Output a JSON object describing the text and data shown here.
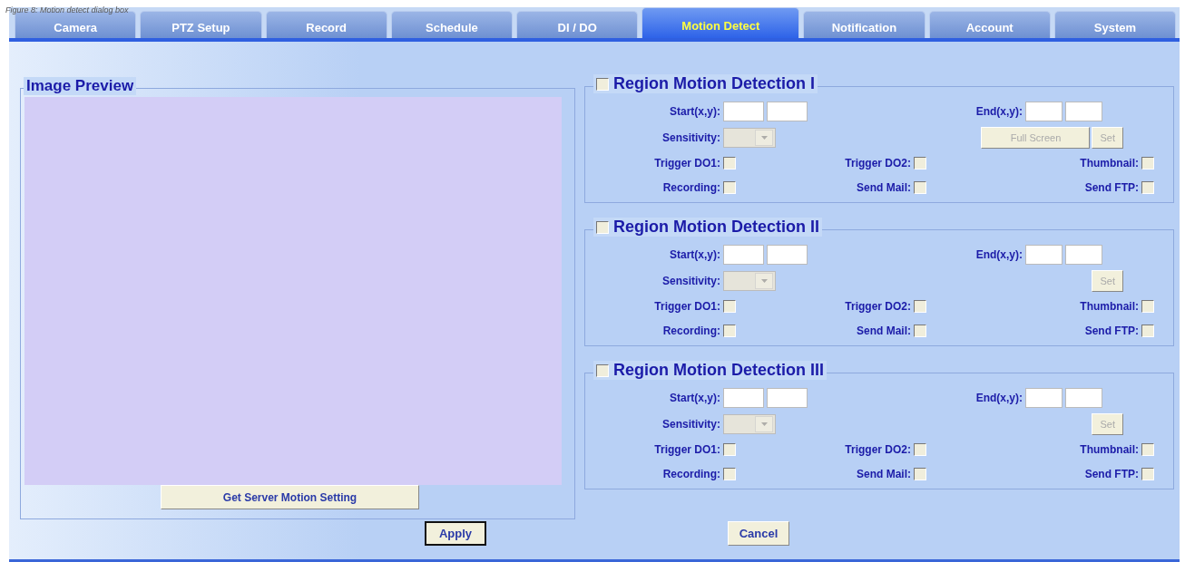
{
  "caption": "Figure 8:   Motion detect dialog box",
  "tabs": [
    {
      "label": "Camera",
      "selected": false
    },
    {
      "label": "PTZ Setup",
      "selected": false
    },
    {
      "label": "Record",
      "selected": false
    },
    {
      "label": "Schedule",
      "selected": false
    },
    {
      "label": "DI / DO",
      "selected": false
    },
    {
      "label": "Motion Detect",
      "selected": true
    },
    {
      "label": "Notification",
      "selected": false
    },
    {
      "label": "Account",
      "selected": false
    },
    {
      "label": "System",
      "selected": false
    }
  ],
  "image_preview": {
    "title": "Image Preview",
    "button": "Get Server Motion Setting"
  },
  "regions": [
    {
      "title": "Region Motion Detection I",
      "enabled": false,
      "start_label": "Start(x,y):",
      "end_label": "End(x,y):",
      "sensitivity_label": "Sensitivity:",
      "sensitivity_disabled": true,
      "buttons": [
        {
          "label": "Full Screen",
          "disabled": true
        },
        {
          "label": "Set",
          "disabled": true
        }
      ],
      "options": [
        {
          "label": "Trigger DO1:",
          "checked": false
        },
        {
          "label": "Trigger DO2:",
          "checked": false
        },
        {
          "label": "Thumbnail:",
          "checked": false
        },
        {
          "label": "Recording:",
          "checked": false
        },
        {
          "label": "Send Mail:",
          "checked": false
        },
        {
          "label": "Send FTP:",
          "checked": false
        }
      ]
    },
    {
      "title": "Region Motion Detection II",
      "enabled": false,
      "start_label": "Start(x,y):",
      "end_label": "End(x,y):",
      "sensitivity_label": "Sensitivity:",
      "sensitivity_disabled": true,
      "buttons": [
        {
          "label": "Set",
          "disabled": true
        }
      ],
      "options": [
        {
          "label": "Trigger DO1:",
          "checked": false
        },
        {
          "label": "Trigger DO2:",
          "checked": false
        },
        {
          "label": "Thumbnail:",
          "checked": false
        },
        {
          "label": "Recording:",
          "checked": false
        },
        {
          "label": "Send Mail:",
          "checked": false
        },
        {
          "label": "Send FTP:",
          "checked": false
        }
      ]
    },
    {
      "title": "Region Motion Detection III",
      "enabled": false,
      "start_label": "Start(x,y):",
      "end_label": "End(x,y):",
      "sensitivity_label": "Sensitivity:",
      "sensitivity_disabled": true,
      "buttons": [
        {
          "label": "Set",
          "disabled": true
        }
      ],
      "options": [
        {
          "label": "Trigger DO1:",
          "checked": false
        },
        {
          "label": "Trigger DO2:",
          "checked": false
        },
        {
          "label": "Thumbnail:",
          "checked": false
        },
        {
          "label": "Recording:",
          "checked": false
        },
        {
          "label": "Send Mail:",
          "checked": false
        },
        {
          "label": "Send FTP:",
          "checked": false
        }
      ]
    }
  ],
  "actions": [
    {
      "label": "Apply",
      "default": true
    },
    {
      "label": "Cancel",
      "default": false
    }
  ]
}
